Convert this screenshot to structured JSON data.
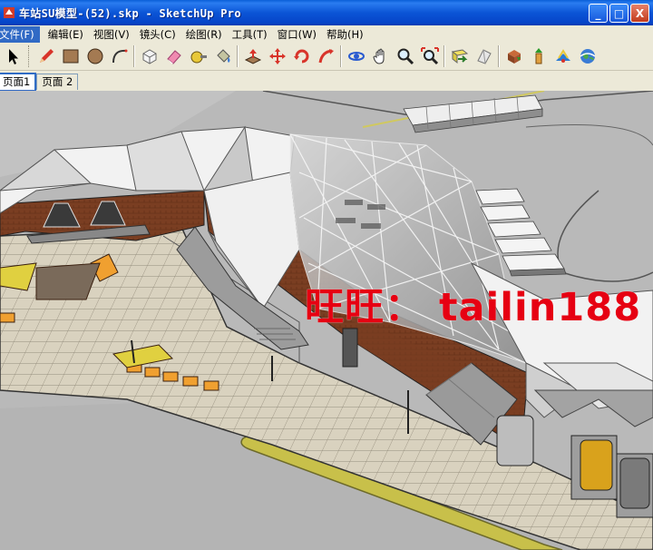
{
  "window": {
    "title": "车站SU模型-(52).skp - SketchUp Pro",
    "minimize_label": "_",
    "maximize_label": "□",
    "close_label": "X"
  },
  "menu": [
    {
      "label": "文件(F)"
    },
    {
      "label": "编辑(E)"
    },
    {
      "label": "视图(V)"
    },
    {
      "label": "镜头(C)"
    },
    {
      "label": "绘图(R)"
    },
    {
      "label": "工具(T)"
    },
    {
      "label": "窗口(W)"
    },
    {
      "label": "帮助(H)"
    }
  ],
  "toolbar": {
    "tools": [
      "select-icon",
      "pencil-icon",
      "rectangle-icon",
      "circle-icon",
      "arc-icon",
      "make-component-icon",
      "eraser-icon",
      "tape-measure-icon",
      "paint-bucket-icon",
      "push-pull-icon",
      "move-icon",
      "rotate-icon",
      "follow-me-icon",
      "orbit-icon",
      "pan-icon",
      "zoom-icon",
      "zoom-extents-icon",
      "previous-view-icon",
      "next-view-icon",
      "get-models-icon",
      "share-model-icon",
      "extension-warehouse-icon",
      "google-earth-icon"
    ]
  },
  "scene_tabs": [
    {
      "label": "页面1",
      "active": true
    },
    {
      "label": "页面 2",
      "active": false
    }
  ],
  "viewport": {
    "watermark": "旺旺： tailin188",
    "watermark_color": "#e60012"
  },
  "colors": {
    "titlebar": "#0b55d6",
    "menubar": "#ece9d8",
    "selection": "#316ac5",
    "ground": "#b9b9b9",
    "plaza": "#d9d2bf",
    "brick": "#7a3e22",
    "roof": "#f2f2f2",
    "road_line": "#c8c04a"
  }
}
